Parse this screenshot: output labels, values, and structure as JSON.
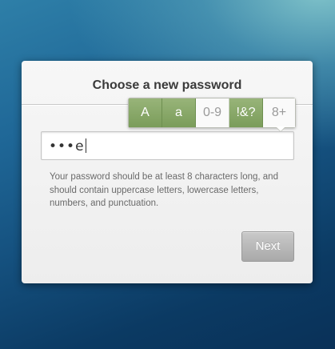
{
  "dialog": {
    "title": "Choose a new password"
  },
  "requirements": [
    {
      "label": "A",
      "met": true
    },
    {
      "label": "a",
      "met": true
    },
    {
      "label": "0-9",
      "met": false
    },
    {
      "label": "!&?",
      "met": true
    },
    {
      "label": "8+",
      "met": false
    }
  ],
  "password_field": {
    "value": "•••e"
  },
  "hint": "Your password should be at least 8 characters long, and should contain uppercase letters, lowercase letters, numbers, and punctuation.",
  "next_button": {
    "label": "Next"
  },
  "colors": {
    "met": "#88a867",
    "unmet": "#fafafa",
    "button": "#b8b8b8"
  }
}
